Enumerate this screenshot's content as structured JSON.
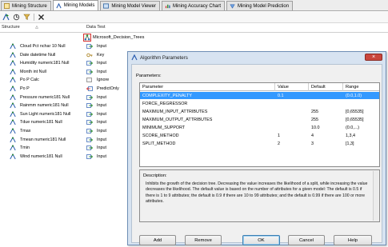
{
  "tabs": [
    {
      "label": "Mining Structure",
      "icon": "structure-icon",
      "active": false
    },
    {
      "label": "Mining Models",
      "icon": "models-icon",
      "active": true
    },
    {
      "label": "Mining Model Viewer",
      "icon": "viewer-icon",
      "active": false
    },
    {
      "label": "Mining Accuracy Chart",
      "icon": "accuracy-chart-icon",
      "active": false
    },
    {
      "label": "Mining Model Prediction",
      "icon": "prediction-icon",
      "active": false
    }
  ],
  "grid": {
    "structure_header": "Structure",
    "sort_glyph": "△",
    "model_header": "Data Test",
    "model_name": "Microsoft_Decision_Trees",
    "rows": [
      {
        "name": "Cloud Pct nchar 10 Null",
        "usage": "Input"
      },
      {
        "name": "Date datetime Null",
        "usage": "Key"
      },
      {
        "name": "Humidity numeric181 Null",
        "usage": "Input"
      },
      {
        "name": "Month int Null",
        "usage": "Input"
      },
      {
        "name": "Po P Calc",
        "usage": "Ignore"
      },
      {
        "name": "Po P",
        "usage": "PredictOnly"
      },
      {
        "name": "Pressure numeric181 Null",
        "usage": "Input"
      },
      {
        "name": "Rainmm numeric181 Null",
        "usage": "Input"
      },
      {
        "name": "Sun Light numeric181 Null",
        "usage": "Input"
      },
      {
        "name": "Tdue numeric181 Null",
        "usage": "Input"
      },
      {
        "name": "Tmax",
        "usage": "Input"
      },
      {
        "name": "Tmean numeric181 Null",
        "usage": "Input"
      },
      {
        "name": "Tmin",
        "usage": "Input"
      },
      {
        "name": "Wind numeric181 Null",
        "usage": "Input"
      }
    ]
  },
  "dialog": {
    "title": "Algorithm Parameters",
    "close_glyph": "×",
    "parameters_label": "Parameters:",
    "columns": [
      "Parameter",
      "Value",
      "Default",
      "Range"
    ],
    "parameters": [
      {
        "name": "COMPLEXITY_PENALTY",
        "value": "0.1",
        "default": "",
        "range": "(0.0,1.0)",
        "selected": true
      },
      {
        "name": "FORCE_REGRESSOR",
        "value": "",
        "default": "",
        "range": ""
      },
      {
        "name": "MAXIMUM_INPUT_ATTRIBUTES",
        "value": "",
        "default": "255",
        "range": "[0,65535]"
      },
      {
        "name": "MAXIMUM_OUTPUT_ATTRIBUTES",
        "value": "",
        "default": "255",
        "range": "[0,65535]"
      },
      {
        "name": "MINIMUM_SUPPORT",
        "value": "",
        "default": "10.0",
        "range": "(0.0,...)"
      },
      {
        "name": "SCORE_METHOD",
        "value": "1",
        "default": "4",
        "range": "1,3,4"
      },
      {
        "name": "SPLIT_METHOD",
        "value": "2",
        "default": "3",
        "range": "[1,3]"
      }
    ],
    "description_label": "Description:",
    "description": "Inhibits the growth of the decision tree. Decreasing the value increases the likelihood of a split, while increasing the value decreases the likelihood. The default value is based on the number of attributes for a given model: The default is 0.5 if there is 1 to 9 attributes; the default is 0.9 if there are 10 to 99 attributes; and the default is 0.99 if there are 100 or more attributes.",
    "buttons": {
      "add": "Add",
      "remove": "Remove",
      "ok": "OK",
      "cancel": "Cancel",
      "help": "Help"
    }
  },
  "colors": {
    "selection": "#3399ff",
    "dialog_frame": "#d7e3f1",
    "close": "#c9463d"
  }
}
